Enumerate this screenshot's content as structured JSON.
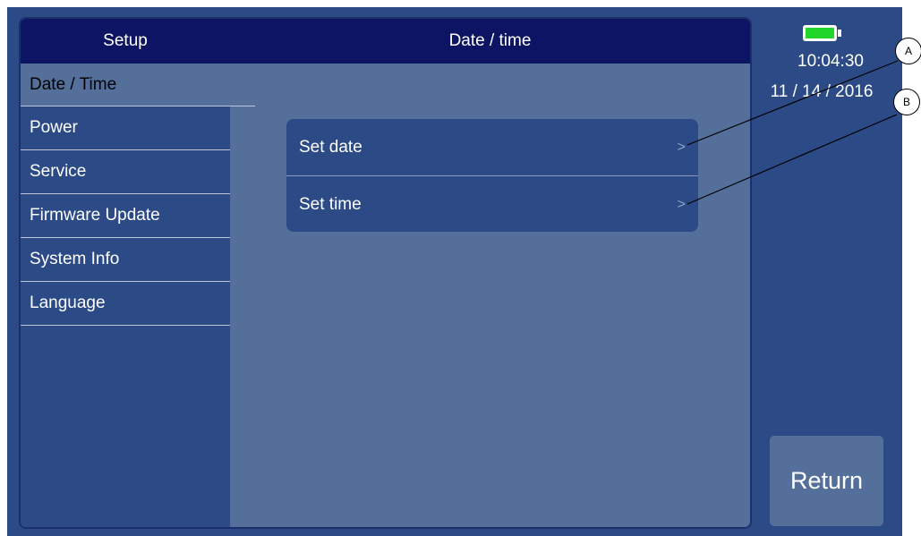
{
  "header": {
    "setup_label": "Setup",
    "page_title": "Date / time"
  },
  "sidebar": {
    "items": [
      {
        "label": "Date / Time",
        "active": true
      },
      {
        "label": "Power"
      },
      {
        "label": "Service"
      },
      {
        "label": "Firmware Update"
      },
      {
        "label": "System Info"
      },
      {
        "label": "Language"
      }
    ]
  },
  "options": [
    {
      "label": "Set date",
      "chevron": ">"
    },
    {
      "label": "Set time",
      "chevron": ">"
    }
  ],
  "status": {
    "time": "10:04:30",
    "date": "11 / 14 / 2016",
    "battery_color": "#22d52a"
  },
  "return_label": "Return",
  "callouts": {
    "a": "A",
    "b": "B"
  }
}
